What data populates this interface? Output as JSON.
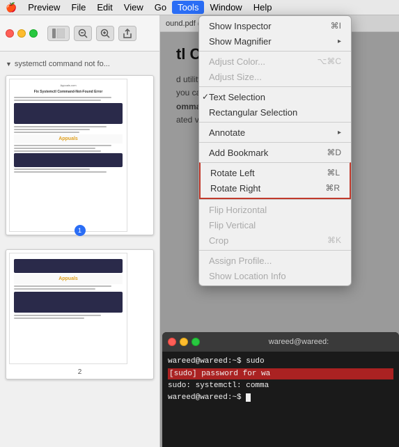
{
  "menubar": {
    "apple": "🍎",
    "items": [
      "Preview",
      "File",
      "Edit",
      "View",
      "Go",
      "Tools",
      "Window",
      "Help"
    ],
    "active": "Tools"
  },
  "toolbar": {
    "sidebar_toggle": "⊞",
    "zoom_out": "−",
    "zoom_in": "+",
    "share": "↑"
  },
  "sidebar": {
    "title": "systemctl command not fo...",
    "page1_number": "1",
    "page2_number": "2"
  },
  "docbar": {
    "title": "ound.pdf (pag"
  },
  "article": {
    "heading": "tl Comm",
    "line1": "d utility for c",
    "line2": "you can easil",
    "line3": "ommand not",
    "line4": "ated version:"
  },
  "terminal": {
    "title": "wareed@wareed:",
    "line1": "wareed@wareed:~$ sudo",
    "line2": "[sudo] password for wa",
    "line3": "sudo: systemctl: comma",
    "line4": "wareed@wareed:~$"
  },
  "tools_menu": {
    "items": [
      {
        "id": "show-inspector",
        "label": "Show Inspector",
        "shortcut": "⌘I",
        "disabled": false,
        "checked": false,
        "submenu": false
      },
      {
        "id": "show-magnifier",
        "label": "Show Magnifier",
        "shortcut": "",
        "disabled": false,
        "checked": false,
        "submenu": false
      }
    ],
    "section2": [
      {
        "id": "adjust-color",
        "label": "Adjust Color...",
        "shortcut": "⌥⌘C",
        "disabled": true,
        "checked": false,
        "submenu": false
      },
      {
        "id": "adjust-size",
        "label": "Adjust Size...",
        "shortcut": "",
        "disabled": true,
        "checked": false,
        "submenu": false
      }
    ],
    "section3": [
      {
        "id": "text-selection",
        "label": "Text Selection",
        "shortcut": "",
        "disabled": false,
        "checked": true,
        "submenu": false
      },
      {
        "id": "rectangular-selection",
        "label": "Rectangular Selection",
        "shortcut": "",
        "disabled": false,
        "checked": false,
        "submenu": false
      }
    ],
    "section4": [
      {
        "id": "annotate",
        "label": "Annotate",
        "shortcut": "",
        "disabled": false,
        "checked": false,
        "submenu": true
      }
    ],
    "section5": [
      {
        "id": "add-bookmark",
        "label": "Add Bookmark",
        "shortcut": "⌘D",
        "disabled": false,
        "checked": false,
        "submenu": false
      }
    ],
    "rotate_section": [
      {
        "id": "rotate-left",
        "label": "Rotate Left",
        "shortcut": "⌘L"
      },
      {
        "id": "rotate-right",
        "label": "Rotate Right",
        "shortcut": "⌘R"
      }
    ],
    "section7": [
      {
        "id": "flip-horizontal",
        "label": "Flip Horizontal",
        "shortcut": "",
        "disabled": true,
        "checked": false,
        "submenu": false
      },
      {
        "id": "flip-vertical",
        "label": "Flip Vertical",
        "shortcut": "",
        "disabled": true,
        "checked": false,
        "submenu": false
      },
      {
        "id": "crop",
        "label": "Crop",
        "shortcut": "⌘K",
        "disabled": true,
        "checked": false,
        "submenu": false
      }
    ],
    "section8": [
      {
        "id": "assign-profile",
        "label": "Assign Profile...",
        "shortcut": "",
        "disabled": true,
        "checked": false,
        "submenu": false
      },
      {
        "id": "show-location-info",
        "label": "Show Location Info",
        "shortcut": "",
        "disabled": true,
        "checked": false,
        "submenu": false
      }
    ]
  }
}
